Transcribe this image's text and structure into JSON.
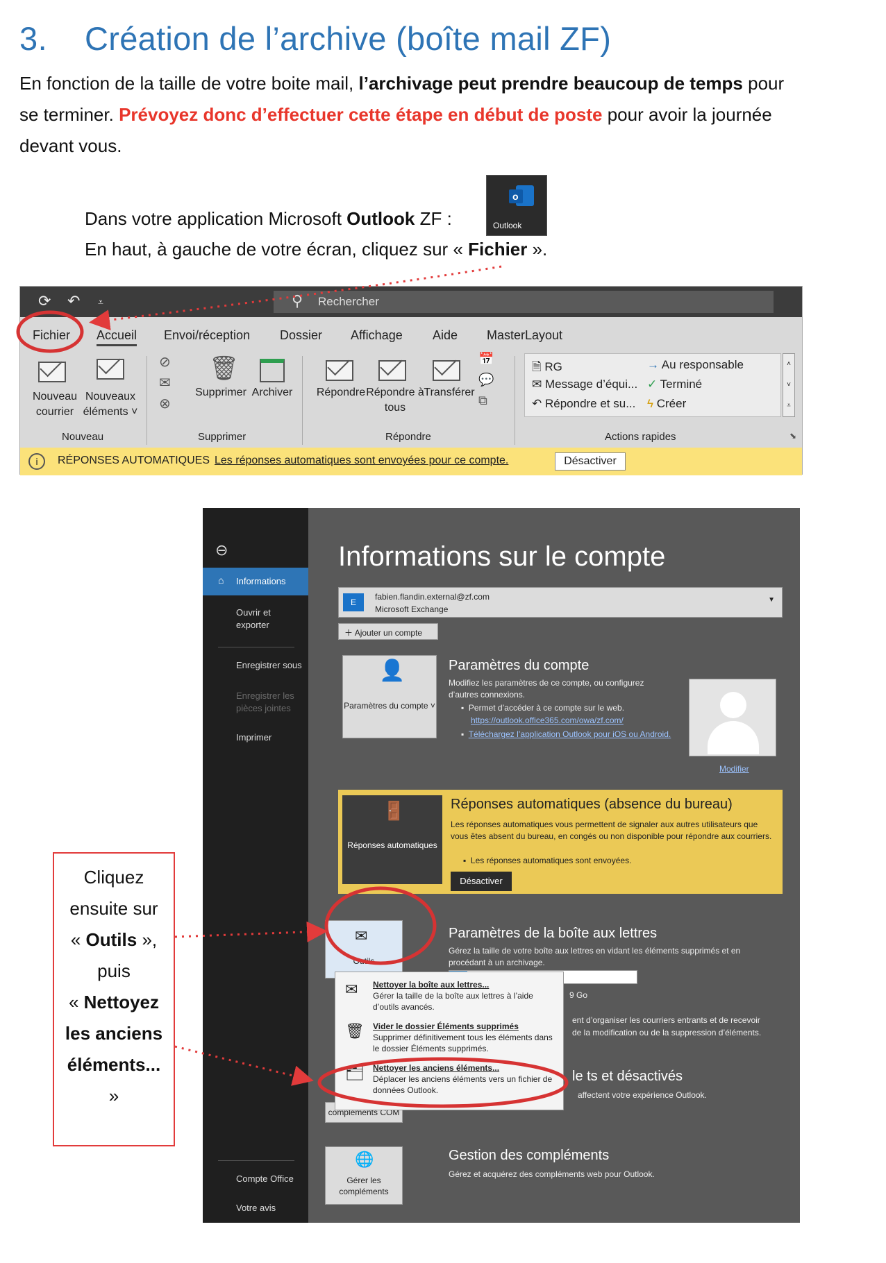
{
  "heading": {
    "number": "3.",
    "title": "Création de l’archive (boîte mail ZF)"
  },
  "intro": {
    "p1": "En fonction de la taille de votre boite mail, ",
    "p1_bold": "l’archivage peut prendre beaucoup de temps",
    "p2": " pour se terminer. ",
    "p2_red": "Prévoyez donc d’effectuer cette étape en début de poste",
    "p3": " pour avoir la journée devant vous."
  },
  "step1": {
    "pre": "Dans votre application Microsoft ",
    "bold": "Outlook",
    "post": " ZF :"
  },
  "outlook_tile_label": "Outlook",
  "step2": {
    "pre": "En haut, à gauche de votre écran, cliquez sur « ",
    "bold": "Fichier",
    "post": " »."
  },
  "ribbon": {
    "search": "Rechercher",
    "tabs": [
      "Fichier",
      "Accueil",
      "Envoi/réception",
      "Dossier",
      "Affichage",
      "Aide",
      "MasterLayout"
    ],
    "buttons": {
      "new_mail": "Nouveau courrier",
      "new_items": "Nouveaux éléments ˅",
      "delete": "Supprimer",
      "archive": "Archiver",
      "reply": "Répondre",
      "reply_all": "Répondre à tous",
      "forward": "Transférer"
    },
    "quick_steps": [
      "RG",
      "Message d’équi...",
      "Répondre et su...",
      "Au responsable",
      "Terminé",
      "Créer"
    ],
    "groups": [
      "Nouveau",
      "Supprimer",
      "Répondre",
      "Actions rapides"
    ],
    "notice": {
      "label": "RÉPONSES AUTOMATIQUES",
      "text": "Les réponses automatiques sont envoyées pour ce compte.",
      "button": "Désactiver"
    }
  },
  "backstage": {
    "nav": [
      "Informations",
      "Ouvrir et exporter",
      "Enregistrer sous",
      "Enregistrer les pièces jointes",
      "Imprimer",
      "Compte Office",
      "Votre avis"
    ],
    "title": "Informations sur le compte",
    "account": {
      "email": "fabien.flandin.external@zf.com",
      "type": "Microsoft Exchange",
      "add": "Ajouter un compte"
    },
    "settings": {
      "card": "Paramètres du compte ˅",
      "heading": "Paramètres du compte",
      "desc": "Modifiez les paramètres de ce compte, ou configurez d’autres connexions.",
      "bullet1": "Permet d’accéder à ce compte sur le web.",
      "link1": "https://outlook.office365.com/owa/zf.com/",
      "link2": "Téléchargez l’application Outlook pour iOS ou Android.",
      "modify": "Modifier"
    },
    "auto_reply": {
      "card": "Réponses automatiques",
      "heading": "Réponses automatiques (absence du bureau)",
      "desc": "Les réponses automatiques vous permettent de signaler aux autres utilisateurs que vous êtes absent du bureau, en congés ou non disponible pour répondre aux courriers.",
      "bullet": "Les réponses automatiques sont envoyées.",
      "button": "Désactiver"
    },
    "mailbox": {
      "card": "Outils",
      "heading": "Paramètres de la boîte aux lettres",
      "desc": "Gérez la taille de votre boîte aux lettres en vidant les éléments supprimés et en procédant à un archivage.",
      "size_fragment": "9 Go"
    },
    "menu": [
      {
        "title": "Nettoyer la boîte aux lettres...",
        "desc": "Gérer la taille de la boîte aux lettres à l’aide d’outils avancés."
      },
      {
        "title": "Vider le dossier Éléments supprimés",
        "desc": "Supprimer définitivement tous les éléments dans le dossier Éléments supprimés."
      },
      {
        "title": "Nettoyer les anciens éléments...",
        "desc": "Déplacer les anciens éléments vers un fichier de données Outlook."
      }
    ],
    "rules_fragment": "ent d’organiser les courriers entrants et de recevoir",
    "rules_fragment2": "de la modification ou de la suppression d’éléments.",
    "com": {
      "heading_fragment": "le    ts et désactivés",
      "desc_fragment": "affectent votre expérience Outlook.",
      "card": "compléments COM"
    },
    "addins": {
      "card": "Gérer les compléments",
      "heading": "Gestion des compléments",
      "desc": "Gérez et acquérez des compléments web pour Outlook."
    }
  },
  "callout": {
    "l1": "Cliquez",
    "l2": "ensuite sur",
    "l3_pre": "« ",
    "l3_bold": "Outils",
    "l3_post": " »,",
    "l4": "puis",
    "l5_pre": "« ",
    "l5_bold": "Nettoyez les anciens éléments...",
    "l6": "»"
  }
}
